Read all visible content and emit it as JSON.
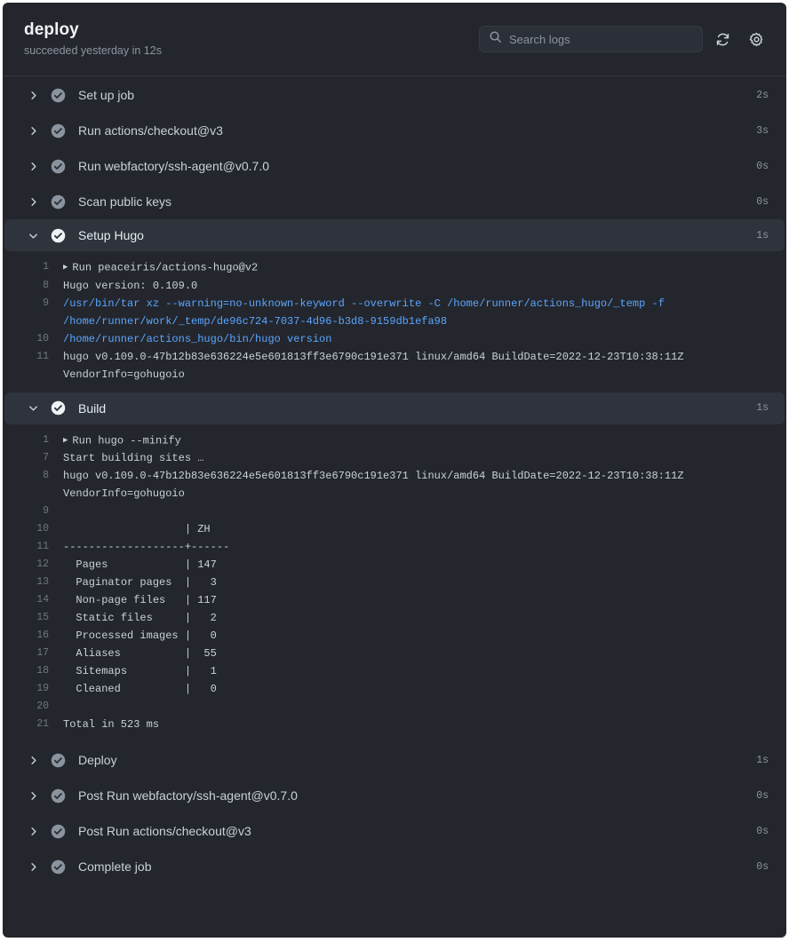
{
  "header": {
    "title": "deploy",
    "subtitle": "succeeded yesterday in 12s",
    "search": {
      "placeholder": "Search logs",
      "value": "",
      "icon": "search-icon"
    },
    "refresh_icon": "sync-icon",
    "settings_icon": "gear-icon"
  },
  "colors": {
    "background": "#24262d",
    "row_expanded": "#2f343c",
    "text": "#c9d1d9",
    "muted": "#8b949e",
    "link": "#58a6ff",
    "border": "#343841"
  },
  "steps": [
    {
      "name": "Set up job",
      "duration": "2s",
      "status": "success",
      "expanded": false,
      "chevron": "chevron-right-icon",
      "lines": []
    },
    {
      "name": "Run actions/checkout@v3",
      "duration": "3s",
      "status": "success",
      "expanded": false,
      "chevron": "chevron-right-icon",
      "lines": []
    },
    {
      "name": "Run webfactory/ssh-agent@v0.7.0",
      "duration": "0s",
      "status": "success",
      "expanded": false,
      "chevron": "chevron-right-icon",
      "lines": []
    },
    {
      "name": "Scan public keys",
      "duration": "0s",
      "status": "success",
      "expanded": false,
      "chevron": "chevron-right-icon",
      "lines": []
    },
    {
      "name": "Setup Hugo",
      "duration": "1s",
      "status": "success",
      "expanded": true,
      "chevron": "chevron-down-icon",
      "lines": [
        {
          "n": "1",
          "text": "Run peaceiris/actions-hugo@v2",
          "style": "plain",
          "marker": true
        },
        {
          "n": "8",
          "text": "Hugo version: 0.109.0",
          "style": "plain",
          "marker": false
        },
        {
          "n": "9",
          "text": "/usr/bin/tar xz --warning=no-unknown-keyword --overwrite -C /home/runner/actions_hugo/_temp -f /home/runner/work/_temp/de96c724-7037-4d96-b3d8-9159db1efa98",
          "style": "cmd",
          "marker": false
        },
        {
          "n": "10",
          "text": "/home/runner/actions_hugo/bin/hugo version",
          "style": "cmd",
          "marker": false
        },
        {
          "n": "11",
          "text": "hugo v0.109.0-47b12b83e636224e5e601813ff3e6790c191e371 linux/amd64 BuildDate=2022-12-23T10:38:11Z VendorInfo=gohugoio",
          "style": "plain",
          "marker": false
        }
      ]
    },
    {
      "name": "Build",
      "duration": "1s",
      "status": "success",
      "expanded": true,
      "chevron": "chevron-down-icon",
      "lines": [
        {
          "n": "1",
          "text": "Run hugo --minify",
          "style": "plain",
          "marker": true
        },
        {
          "n": "7",
          "text": "Start building sites …",
          "style": "plain",
          "marker": false
        },
        {
          "n": "8",
          "text": "hugo v0.109.0-47b12b83e636224e5e601813ff3e6790c191e371 linux/amd64 BuildDate=2022-12-23T10:38:11Z VendorInfo=gohugoio",
          "style": "plain",
          "marker": false
        },
        {
          "n": "9",
          "text": "",
          "style": "plain",
          "marker": false
        },
        {
          "n": "10",
          "text": "                   | ZH",
          "style": "plain",
          "marker": false
        },
        {
          "n": "11",
          "text": "-------------------+------",
          "style": "plain",
          "marker": false
        },
        {
          "n": "12",
          "text": "  Pages            | 147",
          "style": "plain",
          "marker": false
        },
        {
          "n": "13",
          "text": "  Paginator pages  |   3",
          "style": "plain",
          "marker": false
        },
        {
          "n": "14",
          "text": "  Non-page files   | 117",
          "style": "plain",
          "marker": false
        },
        {
          "n": "15",
          "text": "  Static files     |   2",
          "style": "plain",
          "marker": false
        },
        {
          "n": "16",
          "text": "  Processed images |   0",
          "style": "plain",
          "marker": false
        },
        {
          "n": "17",
          "text": "  Aliases          |  55",
          "style": "plain",
          "marker": false
        },
        {
          "n": "18",
          "text": "  Sitemaps         |   1",
          "style": "plain",
          "marker": false
        },
        {
          "n": "19",
          "text": "  Cleaned          |   0",
          "style": "plain",
          "marker": false
        },
        {
          "n": "20",
          "text": "",
          "style": "plain",
          "marker": false
        },
        {
          "n": "21",
          "text": "Total in 523 ms",
          "style": "plain",
          "marker": false
        }
      ]
    },
    {
      "name": "Deploy",
      "duration": "1s",
      "status": "success",
      "expanded": false,
      "chevron": "chevron-right-icon",
      "lines": []
    },
    {
      "name": "Post Run webfactory/ssh-agent@v0.7.0",
      "duration": "0s",
      "status": "success",
      "expanded": false,
      "chevron": "chevron-right-icon",
      "lines": []
    },
    {
      "name": "Post Run actions/checkout@v3",
      "duration": "0s",
      "status": "success",
      "expanded": false,
      "chevron": "chevron-right-icon",
      "lines": []
    },
    {
      "name": "Complete job",
      "duration": "0s",
      "status": "success",
      "expanded": false,
      "chevron": "chevron-right-icon",
      "lines": []
    }
  ]
}
